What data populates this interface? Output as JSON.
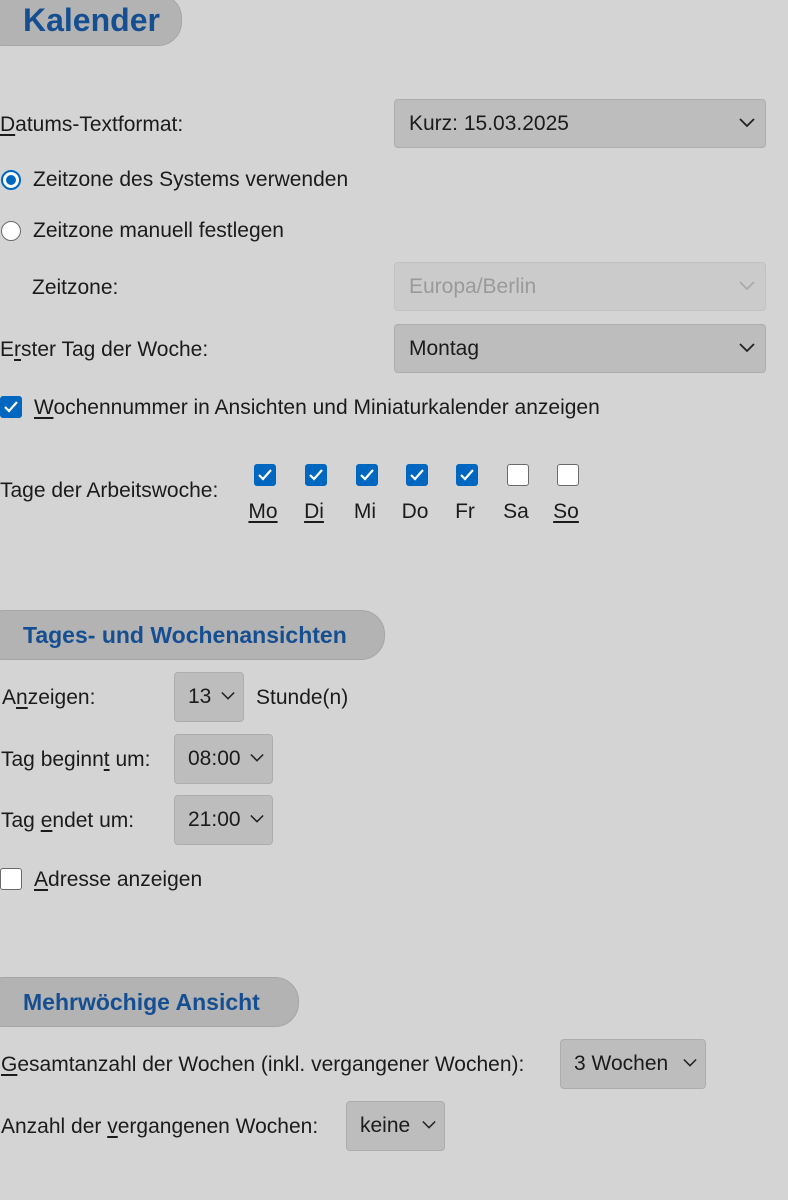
{
  "header": {
    "title": "Kalender"
  },
  "date_format": {
    "label": "Datums-Textformat:",
    "value": "Kurz: 15.03.2025"
  },
  "timezone": {
    "system_option": "Zeitzone des Systems verwenden",
    "manual_option": "Zeitzone manuell festlegen",
    "selected": "system",
    "label": "Zeitzone:",
    "value": "Europa/Berlin"
  },
  "first_day": {
    "label": "Erster Tag der Woche:",
    "value": "Montag"
  },
  "week_numbers": {
    "label": "Wochennummer in Ansichten und Miniaturkalender anzeigen",
    "checked": true
  },
  "workweek": {
    "label": "Tage der Arbeitswoche:",
    "days": [
      {
        "label": "Mo",
        "checked": true
      },
      {
        "label": "Di",
        "checked": true
      },
      {
        "label": "Mi",
        "checked": true
      },
      {
        "label": "Do",
        "checked": true
      },
      {
        "label": "Fr",
        "checked": true
      },
      {
        "label": "Sa",
        "checked": false
      },
      {
        "label": "So",
        "checked": false
      }
    ]
  },
  "day_week_views": {
    "title": "Tages- und Wochenansichten",
    "show_label": "Anzeigen:",
    "show_value": "13",
    "show_unit": "Stunde(n)",
    "start_label": "Tag beginnt um:",
    "start_value": "08:00",
    "end_label": "Tag endet um:",
    "end_value": "21:00",
    "address_label": "Adresse anzeigen",
    "address_checked": false
  },
  "multiweek": {
    "title": "Mehrwöchige Ansicht",
    "total_label": "Gesamtanzahl der Wochen (inkl. vergangener Wochen):",
    "total_value": "3 Wochen",
    "past_label": "Anzahl der vergangenen Wochen:",
    "past_value": "keine"
  },
  "colors": {
    "accent": "#0067c0",
    "heading": "#164f91",
    "background": "#d4d4d4"
  }
}
